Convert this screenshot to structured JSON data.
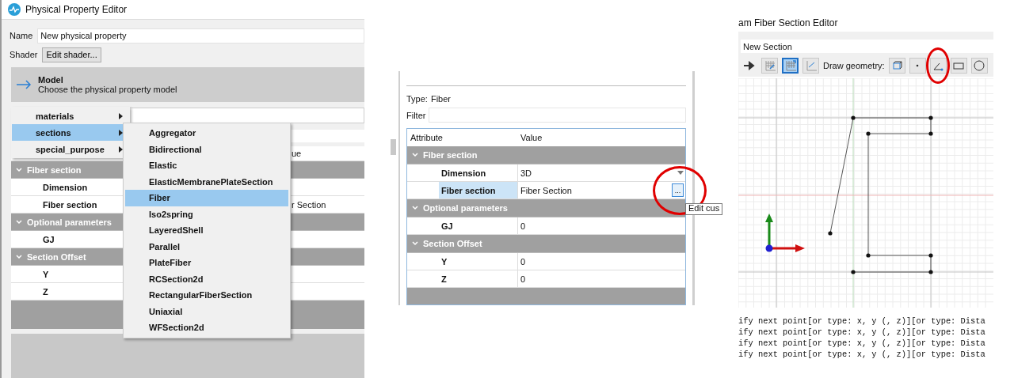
{
  "property_editor": {
    "title": "Physical Property Editor",
    "name_label": "Name",
    "name_value": "New physical property",
    "shader_label": "Shader",
    "shader_button": "Edit shader...",
    "model": {
      "title": "Model",
      "subtitle": "Choose the physical property model"
    },
    "table": {
      "column_2_header": "ue",
      "groups": [
        {
          "label": "Fiber section",
          "expanded": true,
          "rows": [
            {
              "label": "Dimension"
            },
            {
              "label": "Fiber section",
              "value": "r Section"
            }
          ]
        },
        {
          "label": "Optional parameters",
          "expanded": true,
          "rows": [
            {
              "label": "GJ"
            }
          ]
        },
        {
          "label": "Section Offset",
          "expanded": true,
          "rows": [
            {
              "label": "Y"
            },
            {
              "label": "Z"
            }
          ]
        }
      ]
    },
    "menu": [
      {
        "label": "materials",
        "selected": false
      },
      {
        "label": "sections",
        "selected": true
      },
      {
        "label": "special_purpose",
        "selected": false
      }
    ],
    "submenu": [
      {
        "label": "Aggregator",
        "selected": false
      },
      {
        "label": "Bidirectional",
        "selected": false
      },
      {
        "label": "Elastic",
        "selected": false
      },
      {
        "label": "ElasticMembranePlateSection",
        "selected": false
      },
      {
        "label": "Fiber",
        "selected": true
      },
      {
        "label": "Iso2spring",
        "selected": false
      },
      {
        "label": "LayeredShell",
        "selected": false
      },
      {
        "label": "Parallel",
        "selected": false
      },
      {
        "label": "PlateFiber",
        "selected": false
      },
      {
        "label": "RCSection2d",
        "selected": false
      },
      {
        "label": "RectangularFiberSection",
        "selected": false
      },
      {
        "label": "Uniaxial",
        "selected": false
      },
      {
        "label": "WFSection2d",
        "selected": false
      }
    ]
  },
  "attribute_panel": {
    "type_label": "Type:",
    "type_value": "Fiber",
    "filter_label": "Filter",
    "table": {
      "columns": [
        "Attribute",
        "Value"
      ],
      "groups": [
        {
          "label": "Fiber section",
          "expanded": true,
          "rows": [
            {
              "label": "Dimension",
              "value": "3D",
              "kind": "dropdown",
              "selected": false,
              "annotated": false
            },
            {
              "label": "Fiber section",
              "value": "Fiber Section",
              "kind": "button",
              "button_label": "...",
              "selected": true,
              "annotated": true
            }
          ]
        },
        {
          "label": "Optional parameters",
          "expanded": true,
          "rows": [
            {
              "label": "GJ",
              "value": "0",
              "kind": "text",
              "selected": false,
              "annotated": false
            }
          ]
        },
        {
          "label": "Section Offset",
          "expanded": true,
          "rows": [
            {
              "label": "Y",
              "value": "0",
              "kind": "text",
              "selected": false,
              "annotated": false
            },
            {
              "label": "Z",
              "value": "0",
              "kind": "text",
              "selected": false,
              "annotated": false
            }
          ]
        }
      ]
    },
    "tooltip": "Edit cus"
  },
  "section_editor": {
    "title": "am Fiber Section Editor",
    "section_name": "New Section",
    "view_tools": [
      {
        "kind": "arrow",
        "pressed": false
      },
      {
        "kind": "grid-edit",
        "pressed": false
      },
      {
        "kind": "grid-snap",
        "pressed": true
      },
      {
        "kind": "angle-grid",
        "pressed": false
      }
    ],
    "draw_label": "Draw geometry:",
    "draw_tools": [
      {
        "kind": "geometry-box",
        "annotated": false
      },
      {
        "kind": "point",
        "annotated": false
      },
      {
        "kind": "line",
        "annotated": true
      },
      {
        "kind": "rectangle",
        "annotated": false
      },
      {
        "kind": "circle",
        "annotated": false
      }
    ],
    "console": [
      "ify next point[or type: x, y (, z)][or type: Dista",
      "ify next point[or type: x, y (, z)][or type: Dista",
      "ify next point[or type: x, y (, z)][or type: Dista",
      "ify next point[or type: x, y (, z)][or type: Dista"
    ]
  }
}
